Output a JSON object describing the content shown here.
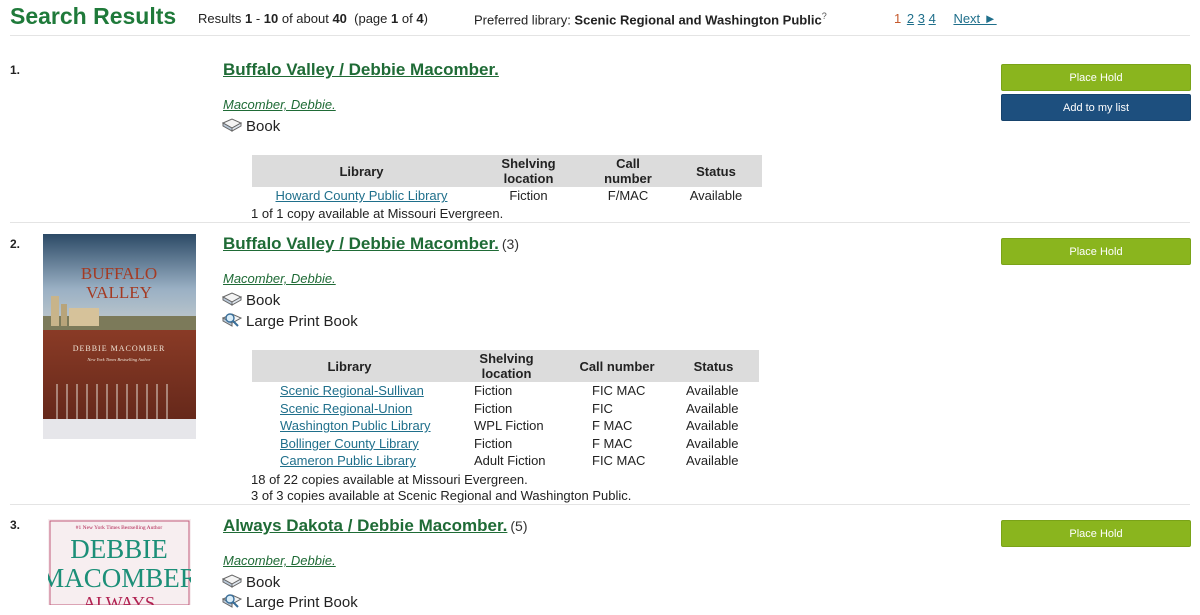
{
  "header": {
    "title": "Search Results",
    "summary_prefix": "Results ",
    "range_start": "1",
    "range_sep": " - ",
    "range_end": "10",
    "of_about": " of about ",
    "total": "40",
    "page_prefix": "  (page ",
    "page_cur": "1",
    "page_of": " of ",
    "page_total": "4",
    "page_suffix": ")",
    "preferred_label": "Preferred library: ",
    "preferred_value": "Scenic Regional and Washington Public",
    "preferred_help": "?",
    "pages": [
      "1",
      "2",
      "3",
      "4"
    ],
    "next_label": "Next ►"
  },
  "buttons": {
    "place_hold": "Place Hold",
    "add_to_list": "Add to my list"
  },
  "table_headers": [
    "Library",
    "Shelving location",
    "Call number",
    "Status"
  ],
  "results": [
    {
      "num": "1.",
      "title": "Buffalo Valley / Debbie Macomber.",
      "count": "",
      "author": "Macomber, Debbie.",
      "formats": [
        "Book"
      ],
      "holdings": [
        [
          "Howard County Public Library",
          "Fiction",
          "F/MAC",
          "Available"
        ]
      ],
      "avail": [
        "1 of 1 copy available at Missouri Evergreen."
      ]
    },
    {
      "num": "2.",
      "title": "Buffalo Valley / Debbie Macomber.",
      "count": "(3)",
      "author": "Macomber, Debbie.",
      "formats": [
        "Book",
        "Large Print Book"
      ],
      "cover": {
        "line1": "BUFFALO",
        "line2": "VALLEY",
        "author": "DEBBIE MACOMBER",
        "tagline": "New York Times Bestselling Author"
      },
      "holdings": [
        [
          "Scenic Regional-Sullivan",
          "Fiction",
          "FIC MAC",
          "Available"
        ],
        [
          "Scenic Regional-Union",
          "Fiction",
          "FIC",
          "Available"
        ],
        [
          "Washington Public Library",
          "WPL Fiction",
          "F MAC",
          "Available"
        ],
        [
          "Bollinger County Library",
          "Fiction",
          "F MAC",
          "Available"
        ],
        [
          "Cameron Public Library",
          "Adult Fiction",
          "FIC MAC",
          "Available"
        ]
      ],
      "avail": [
        "18 of 22 copies available at Missouri Evergreen.",
        "3 of 3 copies available at Scenic Regional and Washington Public."
      ]
    },
    {
      "num": "3.",
      "title": "Always Dakota / Debbie Macomber.",
      "count": "(5)",
      "author": "Macomber, Debbie.",
      "formats": [
        "Book",
        "Large Print Book"
      ],
      "cover": {
        "tagline": "#1 New York Times Bestselling Author",
        "line1": "DEBBIE",
        "line2": "MACOMBER",
        "line3": "ALWAYS"
      }
    }
  ],
  "colors": {
    "title_green": "#1f7a3a",
    "link_blue": "#1f6f8b",
    "hold_green": "#8ab51e",
    "list_blue": "#1d4f7e"
  }
}
